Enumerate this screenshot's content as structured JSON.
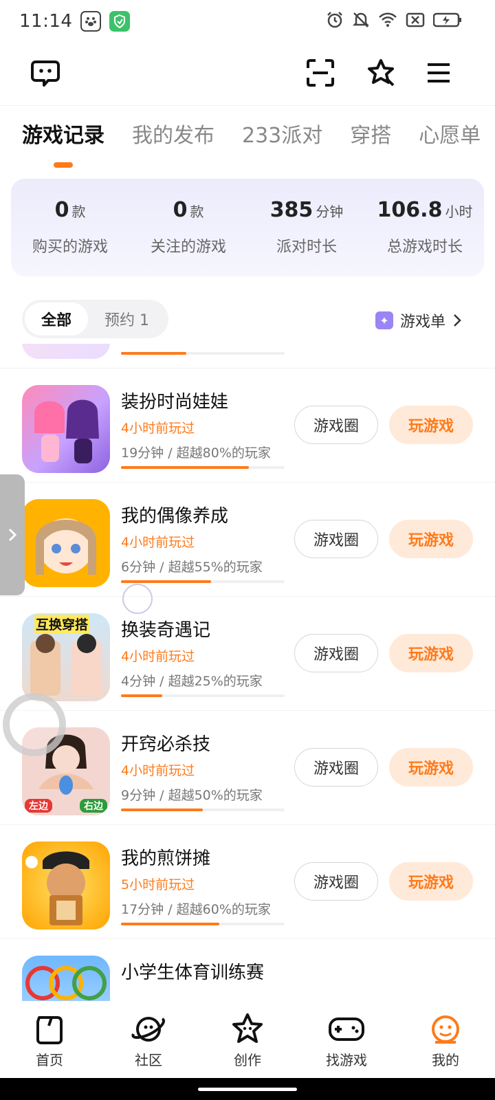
{
  "status_bar": {
    "time": "11:14"
  },
  "tabs": [
    {
      "label": "游戏记录",
      "active": true
    },
    {
      "label": "我的发布",
      "active": false
    },
    {
      "label": "233派对",
      "active": false
    },
    {
      "label": "穿搭",
      "active": false
    },
    {
      "label": "心愿单",
      "active": false
    }
  ],
  "stats": [
    {
      "value": "0",
      "unit": "款",
      "label": "购买的游戏"
    },
    {
      "value": "0",
      "unit": "款",
      "label": "关注的游戏"
    },
    {
      "value": "385",
      "unit": "分钟",
      "label": "派对时长"
    },
    {
      "value": "106.8",
      "unit": "小时",
      "label": "总游戏时长"
    }
  ],
  "filter": {
    "all_label": "全部",
    "reserve_label": "预约 1",
    "game_list_label": "游戏单"
  },
  "games": [
    {
      "name": "装扮时尚娃娃",
      "played": "4小时前玩过",
      "stat": "19分钟 / 超越80%的玩家",
      "progress": 0.78,
      "circle_label": "游戏圈",
      "play_label": "玩游戏"
    },
    {
      "name": "我的偶像养成",
      "played": "4小时前玩过",
      "stat": "6分钟 / 超越55%的玩家",
      "progress": 0.55,
      "circle_label": "游戏圈",
      "play_label": "玩游戏"
    },
    {
      "name": "换装奇遇记",
      "played": "4小时前玩过",
      "stat": "4分钟 / 超越25%的玩家",
      "progress": 0.25,
      "circle_label": "游戏圈",
      "play_label": "玩游戏"
    },
    {
      "name": "开窍必杀技",
      "played": "4小时前玩过",
      "stat": "9分钟 / 超越50%的玩家",
      "progress": 0.5,
      "circle_label": "游戏圈",
      "play_label": "玩游戏"
    },
    {
      "name": "我的煎饼摊",
      "played": "5小时前玩过",
      "stat": "17分钟 / 超越60%的玩家",
      "progress": 0.6,
      "circle_label": "游戏圈",
      "play_label": "玩游戏"
    },
    {
      "name": "小学生体育训练赛",
      "played": "",
      "stat": "",
      "progress": 0,
      "circle_label": "",
      "play_label": ""
    }
  ],
  "thumb_texts": {
    "swap_outfit": "互换穿搭",
    "left": "左边",
    "right": "右边"
  },
  "bottom_nav": [
    {
      "label": "首页",
      "icon": "home-icon",
      "active": false
    },
    {
      "label": "社区",
      "icon": "planet-icon",
      "active": false
    },
    {
      "label": "创作",
      "icon": "star-icon",
      "active": false
    },
    {
      "label": "找游戏",
      "icon": "gamepad-icon",
      "active": false
    },
    {
      "label": "我的",
      "icon": "profile-icon",
      "active": true
    }
  ],
  "colors": {
    "accent": "#ff7a1a",
    "play_bg": "#ffe9d8",
    "card_bg": "#ecebfb",
    "badge": "#9b84f5"
  }
}
